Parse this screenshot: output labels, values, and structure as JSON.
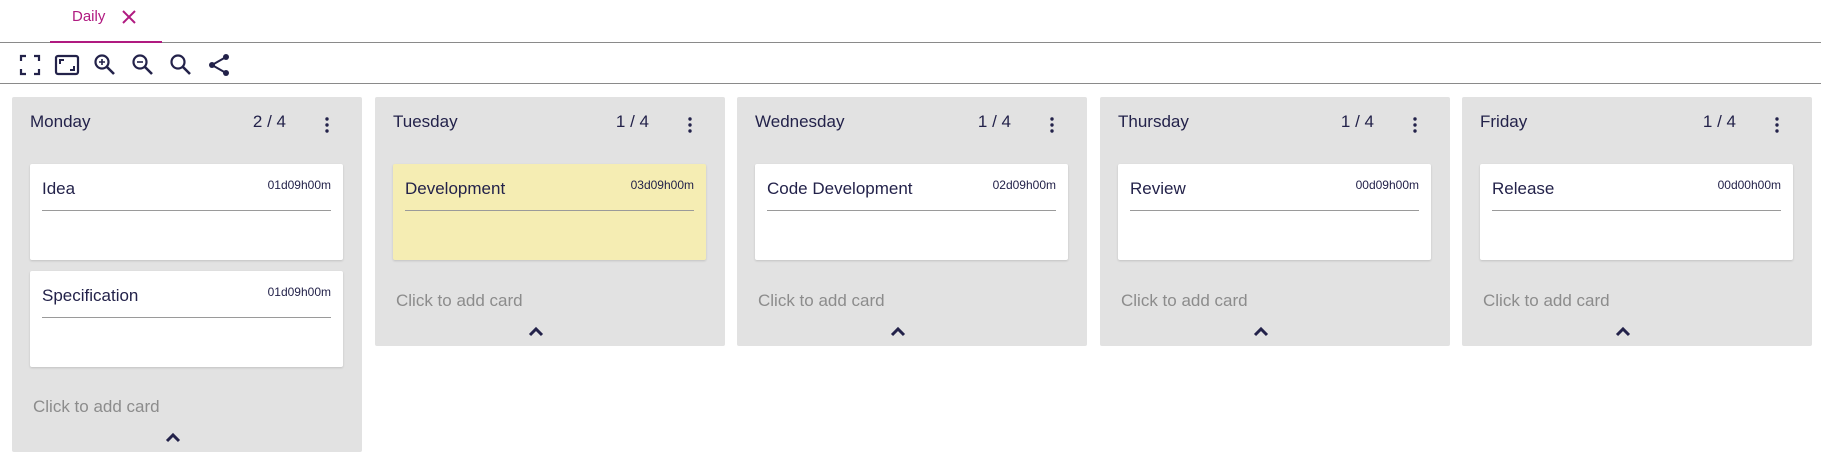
{
  "tab": {
    "label": "Daily"
  },
  "toolbar": {
    "tools": [
      "fullscreen-icon",
      "fit-screen-icon",
      "zoom-in-icon",
      "zoom-out-icon",
      "search-icon",
      "share-icon"
    ]
  },
  "columns": [
    {
      "title": "Monday",
      "count": "2 / 4",
      "cards": [
        {
          "title": "Idea",
          "time": "01d09h00m"
        },
        {
          "title": "Specification",
          "time": "01d09h00m"
        }
      ],
      "add_label": "Click to add card"
    },
    {
      "title": "Tuesday",
      "count": "1 / 4",
      "cards": [
        {
          "title": "Development",
          "time": "03d09h00m"
        }
      ],
      "add_label": "Click to add card"
    },
    {
      "title": "Wednesday",
      "count": "1 / 4",
      "cards": [
        {
          "title": "Code Development",
          "time": "02d09h00m"
        }
      ],
      "add_label": "Click to add card"
    },
    {
      "title": "Thursday",
      "count": "1 / 4",
      "cards": [
        {
          "title": "Review",
          "time": "00d09h00m"
        }
      ],
      "add_label": "Click to add card"
    },
    {
      "title": "Friday",
      "count": "1 / 4",
      "cards": [
        {
          "title": "Release",
          "time": "00d00h00m"
        }
      ],
      "add_label": "Click to add card"
    }
  ],
  "colors": {
    "accent": "#b01a80",
    "column_bg": "#e2e2e2",
    "highlight_card": "#f5edb3",
    "text": "#23224a",
    "muted": "#8c8c8c"
  }
}
